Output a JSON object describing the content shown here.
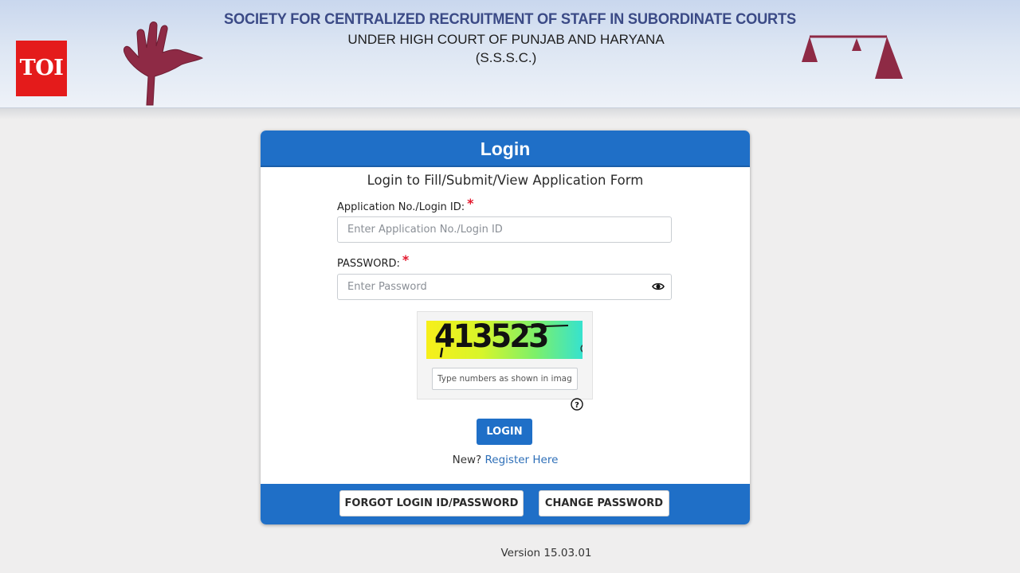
{
  "brand": {
    "toi_logo_text": "TOI"
  },
  "header": {
    "title": "SOCIETY FOR CENTRALIZED RECRUITMENT OF STAFF IN SUBORDINATE COURTS",
    "subtitle": "UNDER HIGH COURT OF PUNJAB AND HARYANA",
    "abbreviation": "(S.S.S.C.)",
    "left_emblem_icon": "raised-hand-icon",
    "right_emblem_icon": "scales-of-justice-icon"
  },
  "login_card": {
    "header_title": "Login",
    "subtitle": "Login to Fill/Submit/View Application Form",
    "application_field": {
      "label": "Application No./Login ID:",
      "required_mark": "*",
      "placeholder": "Enter Application No./Login ID",
      "value": ""
    },
    "password_field": {
      "label": "PASSWORD:",
      "required_mark": "*",
      "placeholder": "Enter Password",
      "value": "",
      "toggle_icon": "eye-icon"
    },
    "captcha": {
      "image_text": "413523",
      "refresh_icon": "refresh-icon",
      "input_placeholder": "Type numbers as shown in image",
      "input_value": "",
      "help_icon": "question-circle-icon"
    },
    "login_button_label": "LOGIN",
    "register": {
      "prompt": "New?",
      "link_label": "Register Here"
    },
    "footer": {
      "forgot_button_label": "FORGOT LOGIN ID/PASSWORD",
      "change_password_button_label": "CHANGE PASSWORD"
    }
  },
  "version_text": "Version 15.03.01",
  "colors": {
    "primary_blue": "#1f6fc7",
    "link_blue": "#2e6fb8",
    "required_red": "#e3182d",
    "toi_red": "#e41b1b",
    "emblem_maroon": "#8e2a45",
    "header_title_blue": "#3b4a86"
  }
}
